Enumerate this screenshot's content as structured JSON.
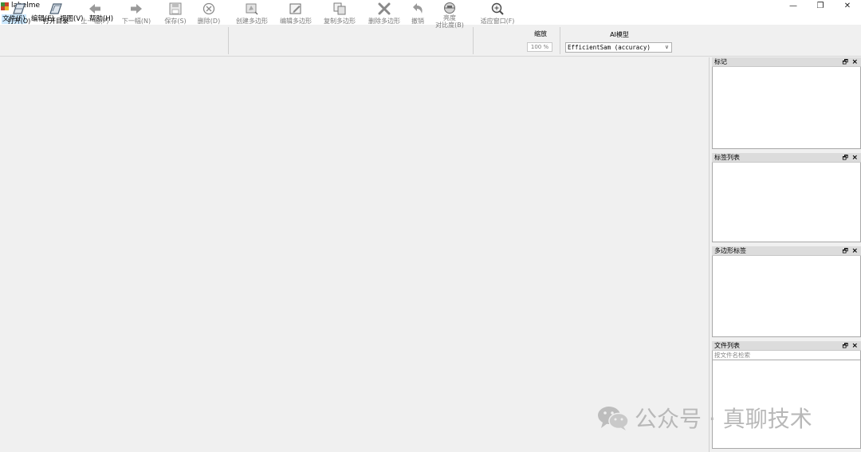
{
  "window": {
    "title": "labelme",
    "controls": {
      "minimize": "—",
      "restore": "❐",
      "close": "✕"
    }
  },
  "menu": [
    {
      "label": "文件(F)"
    },
    {
      "label": "编辑(E)"
    },
    {
      "label": "视图(V)"
    },
    {
      "label": "帮助(H)"
    }
  ],
  "toolbar": {
    "open": "打开(O)",
    "open_dir": "打开目录",
    "prev": "上一幅(P)",
    "next": "下一幅(N)",
    "save": "保存(S)",
    "delete": "删除(D)",
    "create_polygon": "创建多边形",
    "edit_polygon": "编辑多边形",
    "copy_polygon": "复制多边形",
    "delete_polygon": "删除多边形",
    "undo": "撤销",
    "brightness_line1": "亮度",
    "brightness_line2": "对比度(B)",
    "fit_window": "适应窗口(F)",
    "zoom_label": "缩放",
    "zoom_value": "100 %",
    "ai_label": "AI模型",
    "ai_model": "EfficientSam (accuracy)"
  },
  "docks": {
    "flags": {
      "title": "标记"
    },
    "label_list": {
      "title": "标签列表"
    },
    "polygon_labels": {
      "title": "多边形标签"
    },
    "file_list": {
      "title": "文件列表",
      "search_placeholder": "按文件名检索"
    },
    "float_glyph": "🗗",
    "close_glyph": "×"
  },
  "watermark": {
    "text": "公众号 · 真聊技术"
  }
}
